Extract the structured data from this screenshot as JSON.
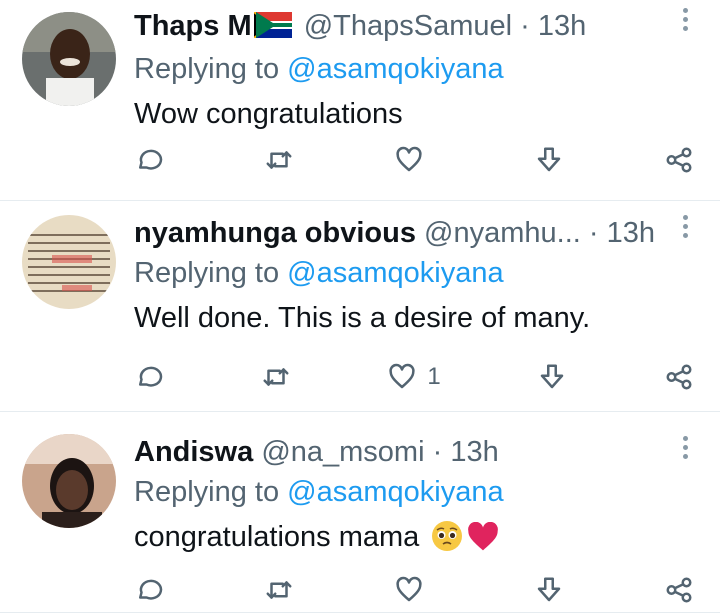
{
  "tweets": [
    {
      "name": "Thaps M",
      "handle": "@ThapsSamuel",
      "dot": "·",
      "time": "13h",
      "replying_prefix": "Replying to",
      "replying_to": "@asamqokiyana",
      "text": "Wow congratulations",
      "like_count": ""
    },
    {
      "name": "nyamhunga obvious",
      "handle": "@nyamhu...",
      "dot": "·",
      "time": "13h",
      "replying_prefix": "Replying to",
      "replying_to": "@asamqokiyana",
      "text": "Well done. This is a desire of many.",
      "like_count": "1"
    },
    {
      "name": "Andiswa",
      "handle": "@na_msomi",
      "dot": "·",
      "time": "13h",
      "replying_prefix": "Replying to",
      "replying_to": "@asamqokiyana",
      "text": "congratulations mama",
      "like_count": ""
    }
  ],
  "icons": {
    "reply": "reply-icon",
    "retweet": "retweet-icon",
    "like": "heart-icon",
    "bookmark": "download-icon",
    "share": "share-icon",
    "more": "more-vertical-icon"
  },
  "colors": {
    "mention": "#1d9bf0",
    "secondary_text": "#536471",
    "primary_text": "#0f1419",
    "divider": "#e6ecf0"
  }
}
